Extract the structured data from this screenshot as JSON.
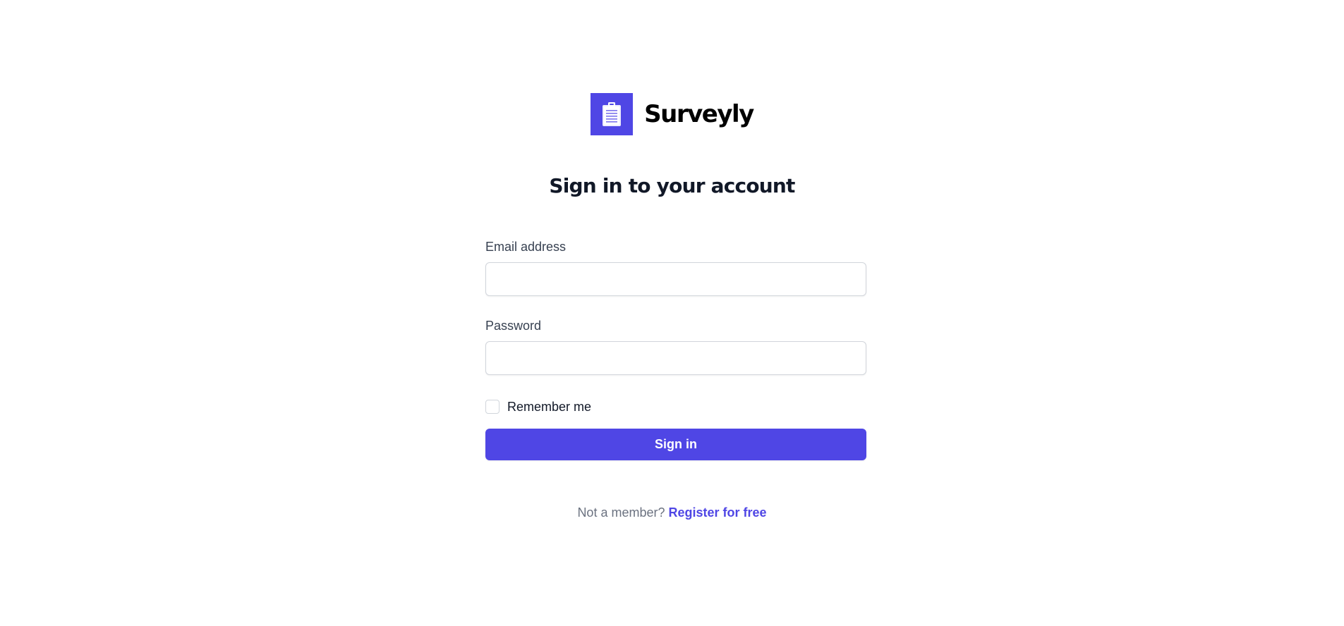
{
  "brand": {
    "name": "Surveyly",
    "logo_icon": "clipboard-icon",
    "accent_color": "#4f46e5"
  },
  "heading": "Sign in to your account",
  "form": {
    "email": {
      "label": "Email address",
      "value": "",
      "placeholder": ""
    },
    "password": {
      "label": "Password",
      "value": "",
      "placeholder": ""
    },
    "remember": {
      "label": "Remember me",
      "checked": false
    },
    "submit_label": "Sign in"
  },
  "footer": {
    "prompt": "Not a member?",
    "register_link": "Register for free"
  }
}
